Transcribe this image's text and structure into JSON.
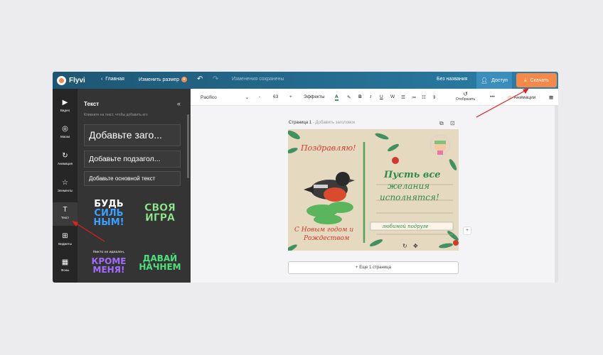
{
  "topbar": {
    "brand": "Flyvi",
    "back": "Главная",
    "resize": "Изменить размер",
    "undo_icon": "undo-icon",
    "redo_icon": "redo-icon",
    "saved_status": "Изменения сохранены",
    "doc_name": "Без названия",
    "access": "Доступ",
    "download": "Скачать"
  },
  "rail": {
    "items": [
      {
        "label": "Видео",
        "icon": "▶"
      },
      {
        "label": "Маски",
        "icon": "◎"
      },
      {
        "label": "Анимация",
        "icon": "↻"
      },
      {
        "label": "Элементы",
        "icon": "☆"
      },
      {
        "label": "Текст",
        "icon": "T"
      },
      {
        "label": "Виджеты",
        "icon": "⊞"
      },
      {
        "label": "Фоны",
        "icon": "▦"
      }
    ]
  },
  "panel": {
    "title": "Текст",
    "hint": "Кликните на текст, чтобы добавить его",
    "heading": "Добавьте заго...",
    "subheading": "Добавьте подзагол...",
    "body": "Добавьте основной текст",
    "presets": {
      "p1": [
        "БУДЬ",
        "СИЛЬ",
        "НЫМ!"
      ],
      "p2": [
        "СВОЯ",
        "ИГРА"
      ],
      "p3_small": "Никто не идеален,",
      "p3": [
        "КРОМЕ",
        "МЕНЯ!"
      ],
      "p4": [
        "ДАВАЙ",
        "НАЧНЕМ"
      ]
    }
  },
  "toolbar": {
    "font": "Pacifico",
    "font_size": "63",
    "minus": "-",
    "plus": "+",
    "effects": "Эффекты",
    "bold": "B",
    "italic": "I",
    "underline": "U",
    "strike": "W",
    "reflect": "Отобразить",
    "more": "•••",
    "animations": "Анимации"
  },
  "canvas": {
    "page_title": "Страница 1",
    "page_sub": "Добавить заголовок",
    "more_pages": "+ Еще 1 страница"
  },
  "postcard": {
    "greeting": "Поздравляю!",
    "wish1": "Пусть все",
    "wish2": "желания",
    "wish3": "исполнятся!",
    "to": "любимой подруге",
    "new_year1": "С Новым годом и",
    "new_year2": "Рождеством"
  },
  "colors": {
    "topbar": "#2b7fa8",
    "accent": "#f5894a",
    "panel": "#343434",
    "rail": "#262626"
  }
}
